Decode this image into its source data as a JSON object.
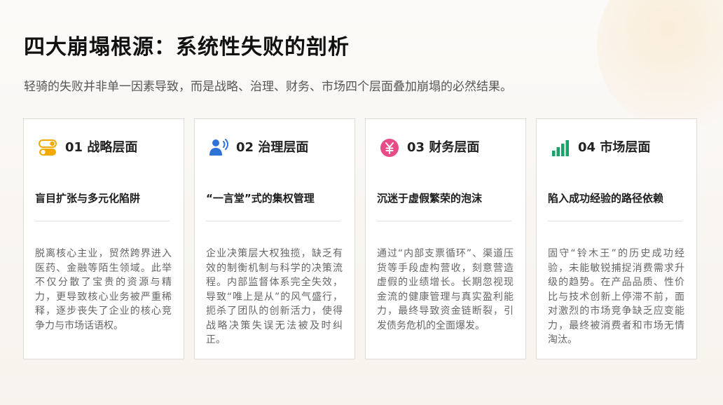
{
  "slide": {
    "title": "四大崩塌根源：系统性失败的剖析",
    "subtitle": "轻骑的失败并非单一因素导致，而是战略、治理、财务、市场四个层面叠加崩塌的必然结果。",
    "cards": [
      {
        "icon": "toggle-switch-icon",
        "color": "#f2a900",
        "title": "01 战略层面",
        "subtitle": "盲目扩张与多元化陷阱",
        "body": "脱离核心主业，贸然跨界进入医药、金融等陌生领域。此举不仅分散了宝贵的资源与精力，更导致核心业务被严重稀释，逐步丧失了企业的核心竞争力与市场话语权。"
      },
      {
        "icon": "speaking-person-icon",
        "color": "#2d73d8",
        "title": "02 治理层面",
        "subtitle": "“一言堂”式的集权管理",
        "body": "企业决策层大权独揽，缺乏有效的制衡机制与科学的决策流程。内部监督体系完全失效，导致“唯上是从”的风气盛行，扼杀了团队的创新活力，使得战略决策失误无法被及时纠正。"
      },
      {
        "icon": "yen-coin-icon",
        "color": "#e74c88",
        "title": "03 财务层面",
        "subtitle": "沉迷于虚假繁荣的泡沫",
        "body": "通过“内部支票循环”、渠道压货等手段虚构营收，刻意营造虚假的业绩增长。长期忽视现金流的健康管理与真实盈利能力，最终导致资金链断裂，引发债务危机的全面爆发。"
      },
      {
        "icon": "bar-chart-icon",
        "color": "#16a36a",
        "title": "04 市场层面",
        "subtitle": "陷入成功经验的路径依赖",
        "body": "固守“铃木王”的历史成功经验，未能敏锐捕捉消费需求升级的趋势。在产品品质、性价比与技术创新上停滞不前，面对激烈的市场竞争缺乏应变能力，最终被消费者和市场无情淘汰。"
      }
    ]
  }
}
